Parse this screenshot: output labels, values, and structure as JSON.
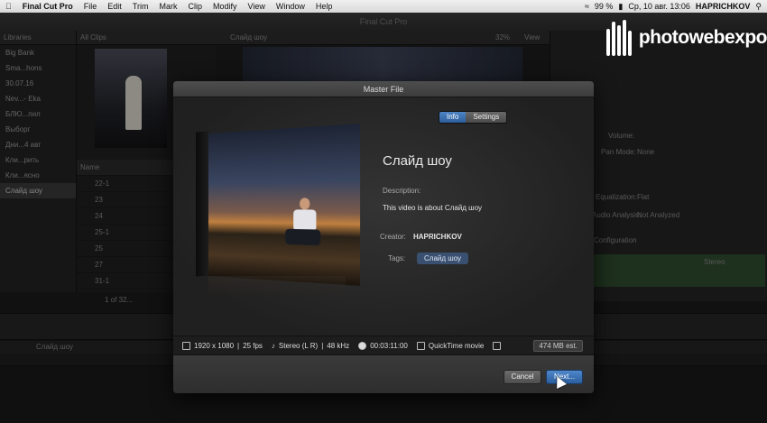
{
  "menubar": {
    "apple": "",
    "app": "Final Cut Pro",
    "items": [
      "File",
      "Edit",
      "Trim",
      "Mark",
      "Clip",
      "Modify",
      "View",
      "Window",
      "Help"
    ],
    "battery": "99 %",
    "datetime": "Ср, 10 авг. 13:06",
    "user": "HAPRICHKOV"
  },
  "window_title": "Final Cut Pro",
  "libraries": {
    "header": "Libraries",
    "items": [
      "Big Bank",
      "Sma...hons",
      "30.07.16",
      "Nev...- Eka",
      "БЛЮ...пил",
      "Выборг",
      "Дни...4 авг",
      "Кли...рить",
      "Кли...ясно",
      "Слайд шоу"
    ]
  },
  "browser": {
    "filter": "All Clips",
    "name_col": "Name",
    "rows": [
      "22-1",
      "23",
      "24",
      "25-1",
      "25",
      "27",
      "31-1"
    ],
    "count": "1 of 32..."
  },
  "viewer": {
    "title": "Слайд шоу",
    "zoom": "32%",
    "view": "View"
  },
  "inspector": {
    "labels": [
      "Volume:",
      "Pan Mode:",
      "None",
      "Equalization:",
      "Flat",
      "Audio Analysis:",
      "Not Analyzed",
      "Configuration",
      "Stereo"
    ]
  },
  "timeline": {
    "project": "Слайд шоу"
  },
  "dialog": {
    "title": "Master File",
    "tabs": {
      "info": "Info",
      "settings": "Settings"
    },
    "project_title": "Слайд шоу",
    "description_label": "Description:",
    "description": "This video is about Слайд шоу",
    "creator_label": "Creator:",
    "creator": "HAPRICHKOV",
    "tags_label": "Tags:",
    "tag": "Слайд шоу",
    "info_bar": {
      "resolution": "1920 x 1080",
      "fps": "25 fps",
      "audio": "Stereo (L R)",
      "sample_rate": "48 kHz",
      "duration": "00:03:11:00",
      "format": "QuickTime movie",
      "size": "474 MB est."
    },
    "buttons": {
      "cancel": "Cancel",
      "next": "Next..."
    }
  },
  "watermark": "photowebexpo",
  "colors": {
    "accent": "#3b72b8",
    "tag": "#3a5070"
  }
}
